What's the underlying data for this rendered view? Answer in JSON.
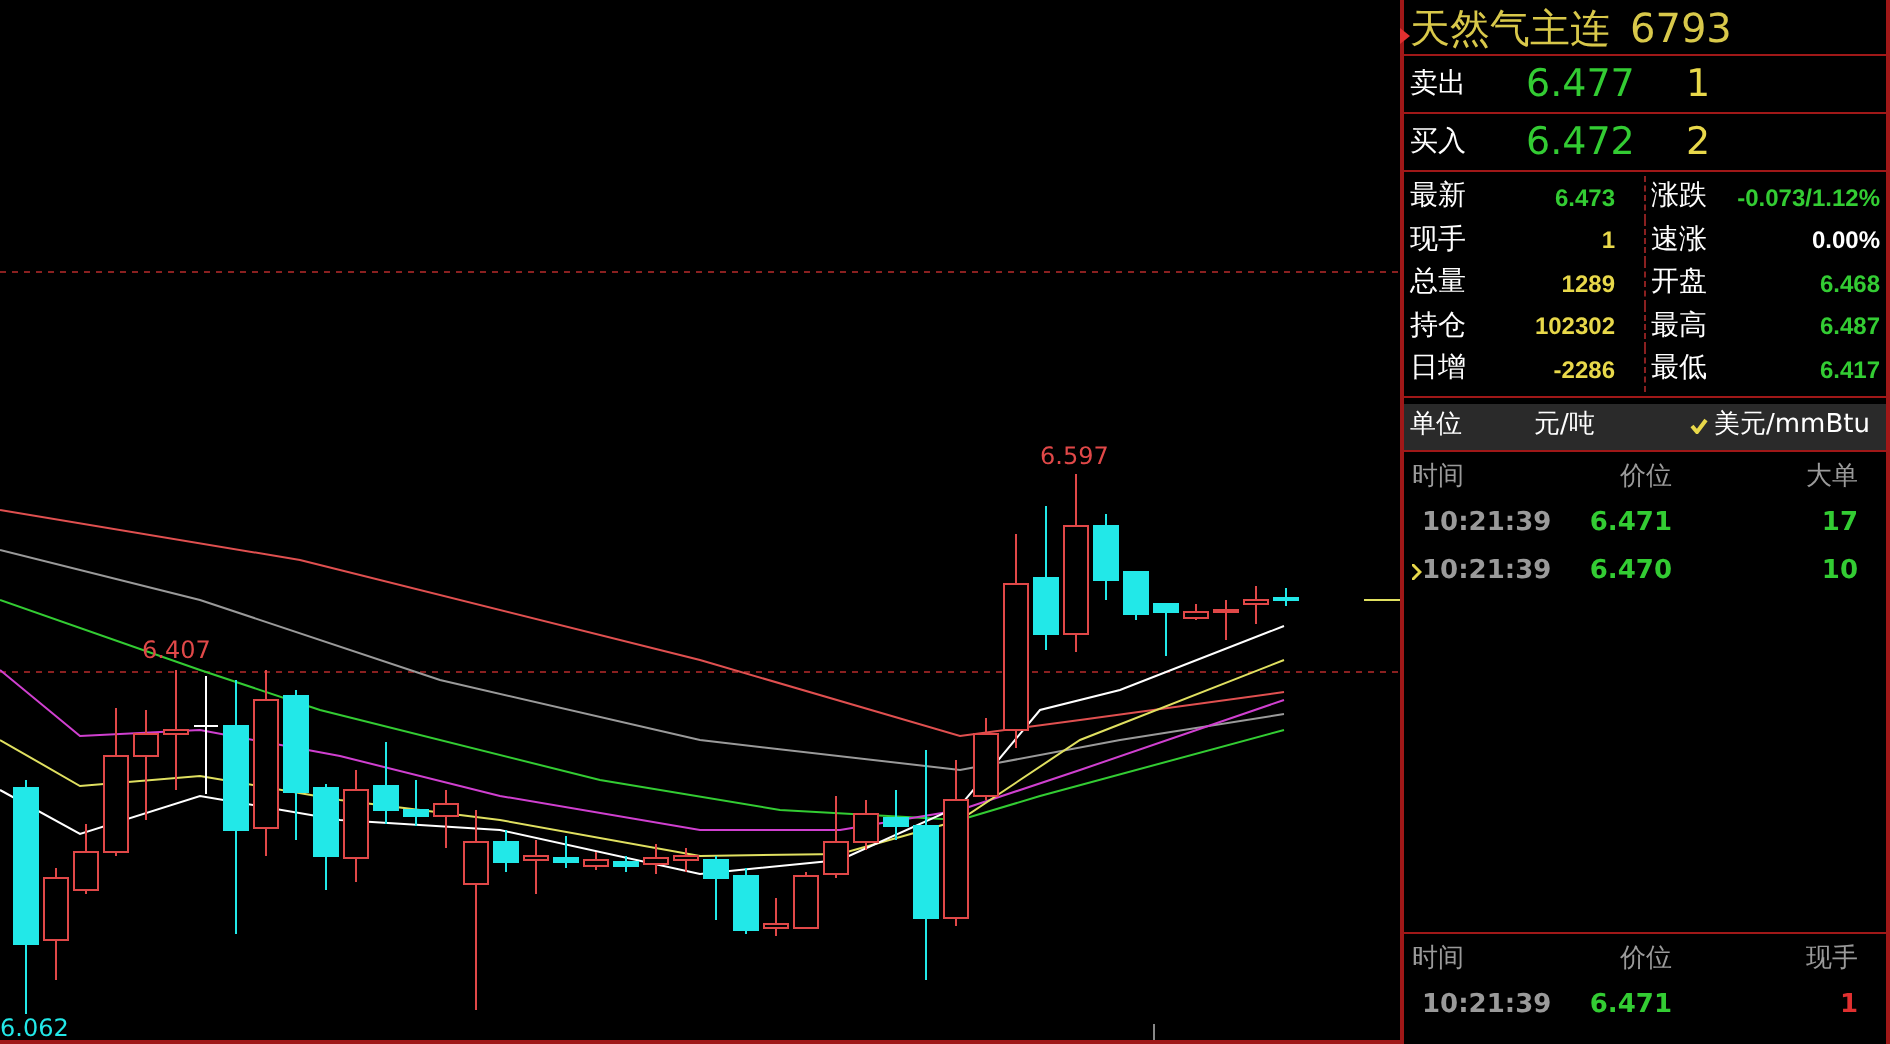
{
  "chart": {
    "high_label": "6.597",
    "low_label": "6.062",
    "local_high_label": "6.407"
  },
  "quote": {
    "name": "天然气主连",
    "code": "6793"
  },
  "book": [
    {
      "label": "卖出",
      "price": "6.477",
      "volume": "1"
    },
    {
      "label": "买入",
      "price": "6.472",
      "volume": "2"
    }
  ],
  "stats": [
    {
      "label": "最新",
      "value": "6.473",
      "color": "#33cc33"
    },
    {
      "label": "涨跌",
      "value": "-0.073/1.12%",
      "color": "#33cc33"
    },
    {
      "label": "现手",
      "value": "1",
      "color": "#e8d84a"
    },
    {
      "label": "速涨",
      "value": "0.00%",
      "color": "#ffffff"
    },
    {
      "label": "总量",
      "value": "1289",
      "color": "#e8d84a"
    },
    {
      "label": "开盘",
      "value": "6.468",
      "color": "#33cc33"
    },
    {
      "label": "持仓",
      "value": "102302",
      "color": "#e8d84a"
    },
    {
      "label": "最高",
      "value": "6.487",
      "color": "#33cc33"
    },
    {
      "label": "日增",
      "value": "-2286",
      "color": "#e8d84a"
    },
    {
      "label": "最低",
      "value": "6.417",
      "color": "#33cc33"
    }
  ],
  "unit": {
    "label": "单位",
    "options": [
      {
        "label": "元/吨",
        "checked": false
      },
      {
        "label": "美元/mmBtu",
        "checked": true
      }
    ]
  },
  "big_orders": {
    "columns": [
      "时间",
      "价位",
      "大单"
    ],
    "rows": [
      {
        "time": "10:21:39",
        "price": "6.471",
        "volume": "17",
        "color": "#33cc33",
        "marked": false
      },
      {
        "time": "10:21:39",
        "price": "6.470",
        "volume": "10",
        "color": "#33cc33",
        "marked": true
      }
    ]
  },
  "ticks": {
    "columns": [
      "时间",
      "价位",
      "现手"
    ],
    "rows": [
      {
        "time": "10:21:39",
        "price": "6.471",
        "volume": "1",
        "color": "#e03030"
      }
    ]
  }
}
